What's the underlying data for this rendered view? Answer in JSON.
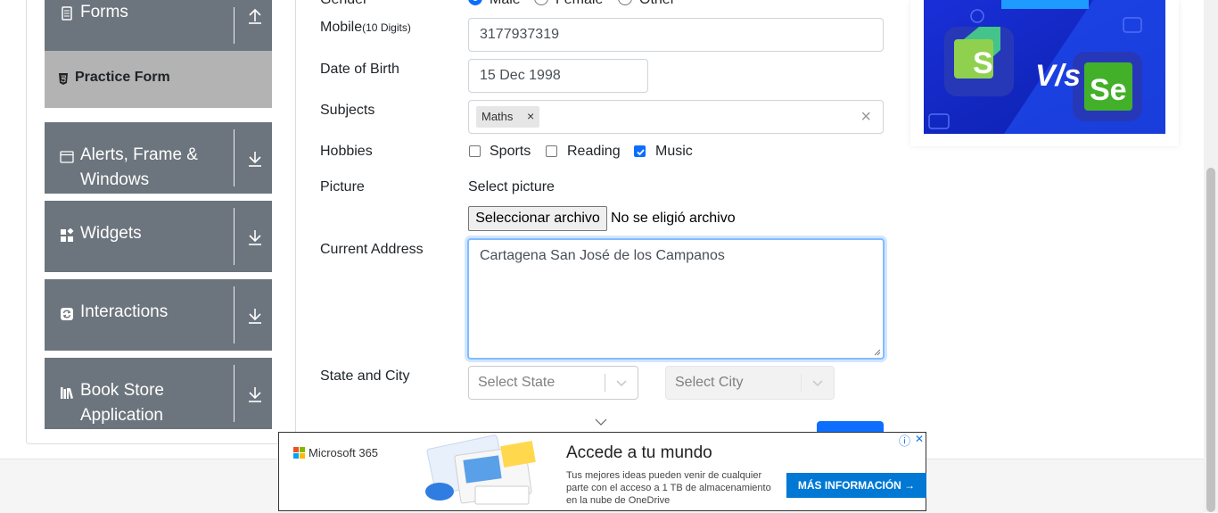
{
  "sidebar": {
    "groups": [
      {
        "label": "Forms"
      },
      {
        "label": "Alerts, Frame & Windows",
        "line1": "Alerts, Frame &",
        "line2": "Windows"
      },
      {
        "label": "Widgets"
      },
      {
        "label": "Interactions"
      },
      {
        "label": "Book Store Application",
        "line1": "Book Store",
        "line2": "Application"
      }
    ],
    "active_item": "Practice Form"
  },
  "form": {
    "gender": {
      "label": "Gender",
      "options": [
        "Male",
        "Female",
        "Other"
      ]
    },
    "mobile": {
      "label": "Mobile",
      "hint": "(10 Digits)",
      "value": "3177937319"
    },
    "dob": {
      "label": "Date of Birth",
      "value": "15 Dec 1998"
    },
    "subjects": {
      "label": "Subjects",
      "tags": [
        "Maths"
      ],
      "remove_glyph": "×",
      "clear_glyph": "×"
    },
    "hobbies": {
      "label": "Hobbies",
      "options": [
        {
          "label": "Sports",
          "checked": false
        },
        {
          "label": "Reading",
          "checked": false
        },
        {
          "label": "Music",
          "checked": true
        }
      ]
    },
    "picture": {
      "label": "Picture",
      "prompt": "Select picture",
      "button": "Seleccionar archivo",
      "status": "No se eligió archivo"
    },
    "address": {
      "label": "Current Address",
      "value": "Cartagena San José de los Campanos"
    },
    "state_city": {
      "label": "State and City",
      "state_placeholder": "Select State",
      "city_placeholder": "Select City"
    }
  },
  "right_ad": {
    "vs_text": "V/s",
    "logo_left": "S",
    "logo_right": "Se"
  },
  "bottom_ad": {
    "brand": "Microsoft 365",
    "headline": "Accede a tu mundo",
    "body_line1": "Tus mejores ideas pueden venir de cualquier",
    "body_line2": "parte con el acceso a 1 TB de almacenamiento",
    "body_line3": "en la nube de OneDrive",
    "cta": "MÁS INFORMACIÓN →",
    "info_glyph": "ⓘ",
    "close_glyph": "✕"
  },
  "colors": {
    "sidebar_bg": "#6c757d",
    "active_bg": "#b3b3b3",
    "accent": "#0d6efd",
    "ad_blue": "#0078d4"
  }
}
